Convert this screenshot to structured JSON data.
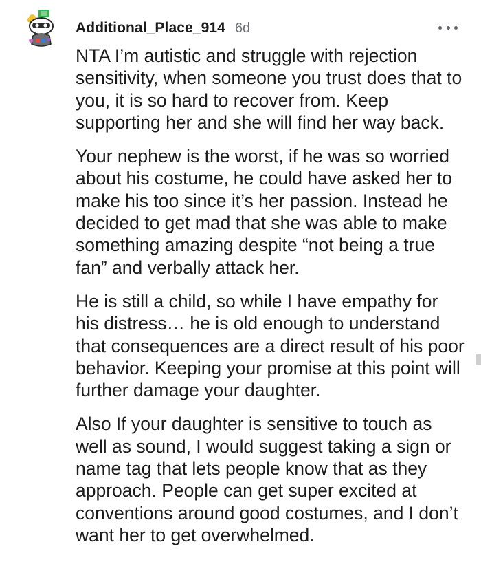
{
  "comment": {
    "username": "Additional_Place_914",
    "timestamp": "6d",
    "more_icon": "more-horizontal-icon",
    "avatar_icon": "snoo-avatar-icon",
    "paragraphs": [
      "NTA I’m autistic and struggle with rejection sensitivity, when someone you trust does that to you, it is so hard to recover from. Keep supporting her and she will find her way back.",
      "Your nephew is the worst, if he was so worried about his costume, he could have asked her to make his too since it’s her passion. Instead he decided to get mad that she was able to make something amazing despite “not being a true fan” and verbally attack her.",
      "He is still a child, so while I have empathy for his distress… he is old enough to understand that consequences are a direct result of his poor behavior. Keeping your promise at this point will further damage your daughter.",
      "Also If your daughter is sensitive to touch as well as sound, I would suggest taking a sign or name tag that lets people know that as they approach. People can get super excited at conventions around good costumes, and I don’t want her to get overwhelmed."
    ]
  },
  "colors": {
    "username": "#1a1a1b",
    "timestamp": "#6e7174",
    "body_text": "#1c1c1c",
    "background": "#ffffff"
  }
}
